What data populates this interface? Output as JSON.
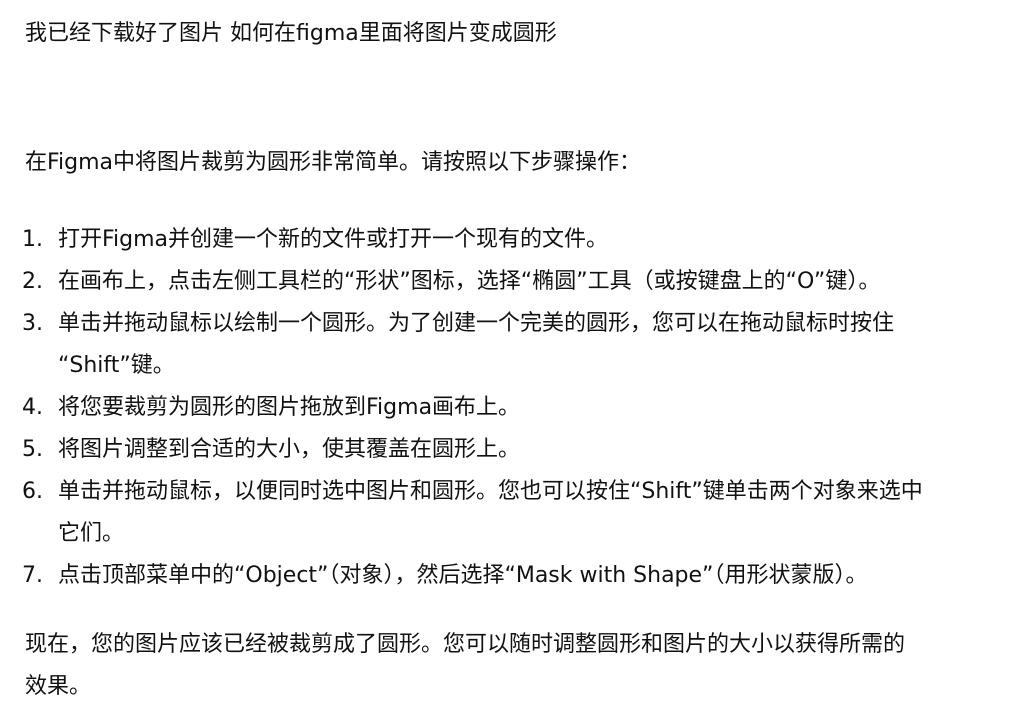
{
  "question": "我已经下载好了图片 如何在figma里面将图片变成圆形",
  "intro": "在Figma中将图片裁剪为圆形非常简单。请按照以下步骤操作：",
  "steps": [
    {
      "num": "1.",
      "lines": [
        "打开Figma并创建一个新的文件或打开一个现有的文件。"
      ]
    },
    {
      "num": "2.",
      "lines": [
        "在画布上，点击左侧工具栏的“形状”图标，选择“椭圆”工具（或按键盘上的“O”键）。"
      ]
    },
    {
      "num": "3.",
      "lines": [
        "单击并拖动鼠标以绘制一个圆形。为了创建一个完美的圆形，您可以在拖动鼠标时按住",
        "“Shift”键。"
      ]
    },
    {
      "num": "4.",
      "lines": [
        "将您要裁剪为圆形的图片拖放到Figma画布上。"
      ]
    },
    {
      "num": "5.",
      "lines": [
        "将图片调整到合适的大小，使其覆盖在圆形上。"
      ]
    },
    {
      "num": "6.",
      "lines": [
        "单击并拖动鼠标，以便同时选中图片和圆形。您也可以按住“Shift”键单击两个对象来选中",
        "它们。"
      ]
    },
    {
      "num": "7.",
      "lines": [
        "点击顶部菜单中的“Object”（对象），然后选择“Mask with Shape”（用形状蒙版）。"
      ]
    }
  ],
  "outro_lines": [
    "现在，您的图片应该已经被裁剪成了圆形。您可以随时调整圆形和图片的大小以获得所需的",
    "效果。"
  ]
}
